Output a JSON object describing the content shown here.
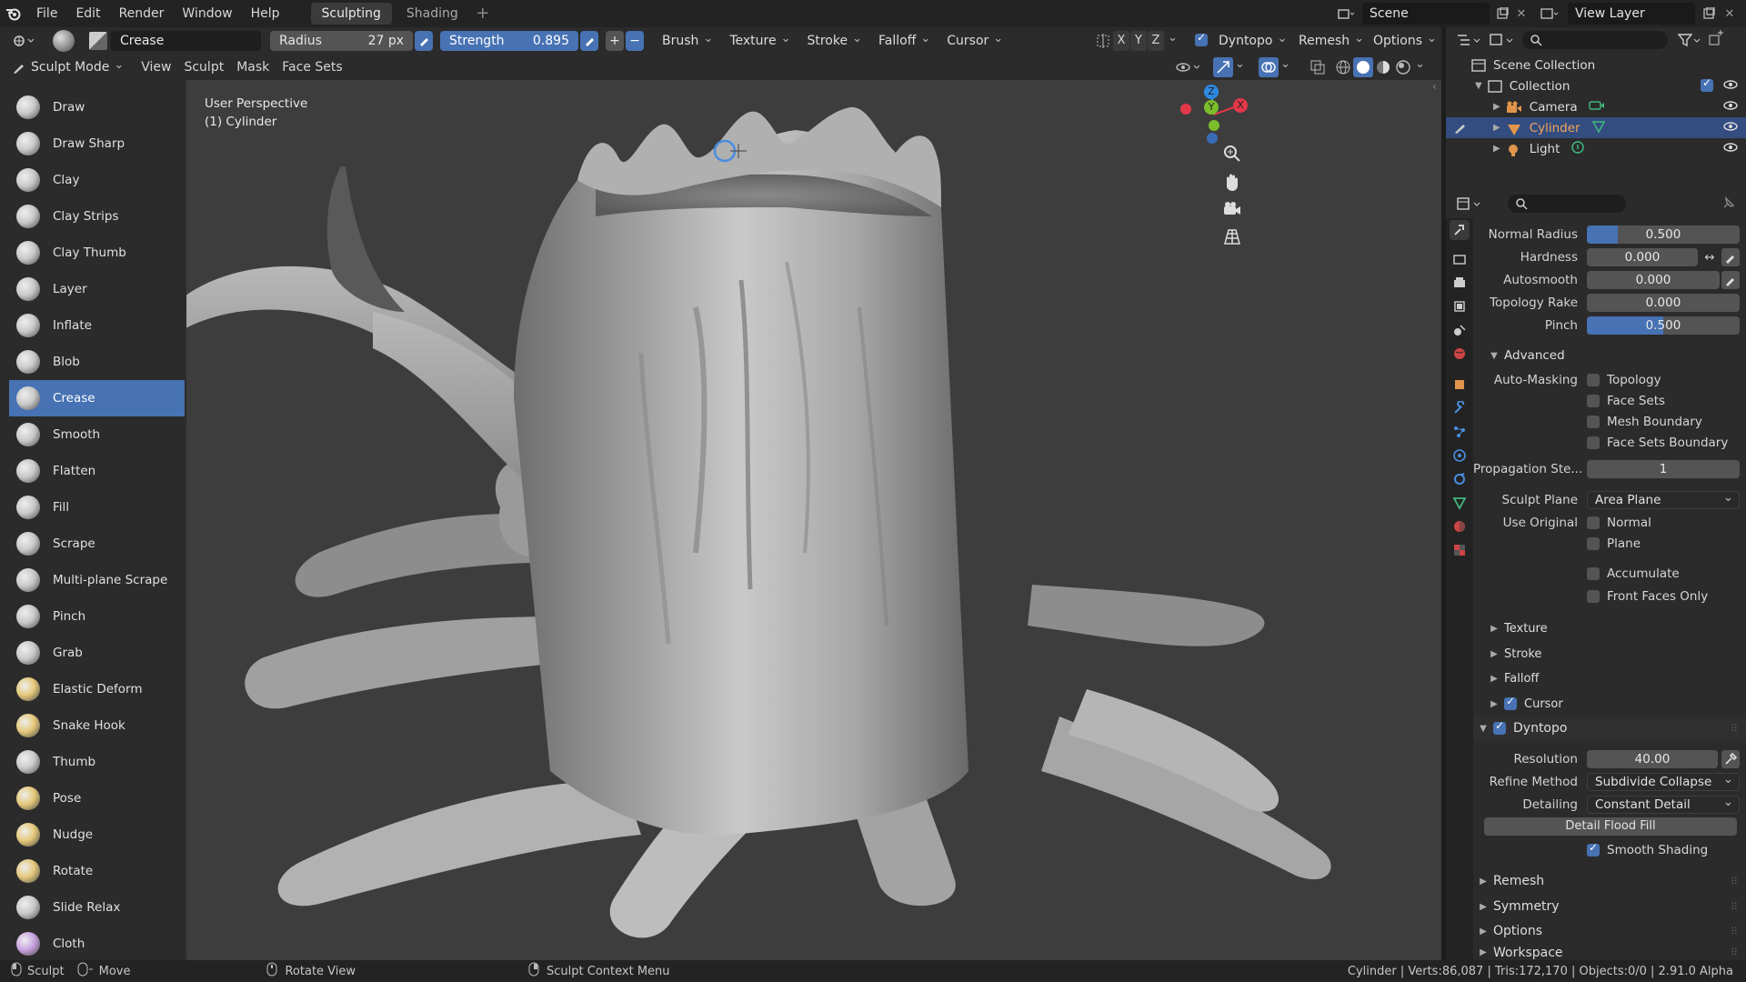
{
  "menubar": {
    "items": [
      "File",
      "Edit",
      "Render",
      "Window",
      "Help"
    ],
    "workspaces": [
      "Sculpting",
      "Shading"
    ],
    "add_workspace": "+",
    "scene": "Scene",
    "view_layer": "View Layer"
  },
  "toolhdr": {
    "brush_name": "Crease",
    "radius_label": "Radius",
    "radius_value": "27 px",
    "strength_label": "Strength",
    "strength_value": "0.895",
    "menus": [
      "Brush",
      "Texture",
      "Stroke",
      "Falloff",
      "Cursor"
    ],
    "axes": [
      "X",
      "Y",
      "Z"
    ],
    "dyntopo": "Dyntopo",
    "remesh": "Remesh",
    "options": "Options"
  },
  "modehdr": {
    "mode": "Sculpt Mode",
    "items": [
      "View",
      "Sculpt",
      "Mask",
      "Face Sets"
    ]
  },
  "tools": [
    {
      "label": "Draw"
    },
    {
      "label": "Draw Sharp"
    },
    {
      "label": "Clay"
    },
    {
      "label": "Clay Strips"
    },
    {
      "label": "Clay Thumb"
    },
    {
      "label": "Layer"
    },
    {
      "label": "Inflate"
    },
    {
      "label": "Blob"
    },
    {
      "label": "Crease"
    },
    {
      "label": "Smooth"
    },
    {
      "label": "Flatten"
    },
    {
      "label": "Fill"
    },
    {
      "label": "Scrape"
    },
    {
      "label": "Multi-plane Scrape"
    },
    {
      "label": "Pinch"
    },
    {
      "label": "Grab"
    },
    {
      "label": "Elastic Deform"
    },
    {
      "label": "Snake Hook"
    },
    {
      "label": "Thumb"
    },
    {
      "label": "Pose"
    },
    {
      "label": "Nudge"
    },
    {
      "label": "Rotate"
    },
    {
      "label": "Slide Relax"
    },
    {
      "label": "Cloth"
    }
  ],
  "active_tool": "Crease",
  "viewport": {
    "perspective": "User Perspective",
    "object": "(1) Cylinder",
    "gizmo": {
      "x": "X",
      "y": "Y",
      "z": "Z"
    }
  },
  "outliner": {
    "root": "Scene Collection",
    "collection": "Collection",
    "objects": [
      {
        "label": "Camera",
        "selected": false
      },
      {
        "label": "Cylinder",
        "selected": true
      },
      {
        "label": "Light",
        "selected": false
      }
    ]
  },
  "props": {
    "normal_radius": {
      "label": "Normal Radius",
      "value": "0.500",
      "fill": 0.2
    },
    "hardness": {
      "label": "Hardness",
      "value": "0.000"
    },
    "autosmooth": {
      "label": "Autosmooth",
      "value": "0.000"
    },
    "topology_rake": {
      "label": "Topology Rake",
      "value": "0.000"
    },
    "pinch": {
      "label": "Pinch",
      "value": "0.500",
      "fill": 0.5
    },
    "advanced": "Advanced",
    "auto_masking": "Auto-Masking",
    "masking_opts": [
      "Topology",
      "Face Sets",
      "Mesh Boundary",
      "Face Sets Boundary"
    ],
    "propagation": {
      "label": "Propagation Ste...",
      "value": "1"
    },
    "sculpt_plane": {
      "label": "Sculpt Plane",
      "value": "Area Plane"
    },
    "use_original": {
      "label": "Use Original",
      "opts": [
        "Normal",
        "Plane"
      ]
    },
    "accumulate": "Accumulate",
    "front_faces": "Front Faces Only",
    "sub_sections": [
      "Texture",
      "Stroke",
      "Falloff"
    ],
    "cursor": "Cursor",
    "dyntopo": "Dyntopo",
    "resolution": {
      "label": "Resolution",
      "value": "40.00"
    },
    "refine": {
      "label": "Refine Method",
      "value": "Subdivide Collapse"
    },
    "detailing": {
      "label": "Detailing",
      "value": "Constant Detail"
    },
    "flood_fill": "Detail Flood Fill",
    "smooth_shading": "Smooth Shading",
    "bottom_sections": [
      "Remesh",
      "Symmetry",
      "Options",
      "Workspace"
    ]
  },
  "statusbar": {
    "sculpt": "Sculpt",
    "move": "Move",
    "rotate": "Rotate View",
    "context": "Sculpt Context Menu",
    "stats": "Cylinder | Verts:86,087 | Tris:172,170 | Objects:0/0 | 2.91.0 Alpha"
  },
  "colors": {
    "accent": "#4772b3",
    "selected_row": "#334d80",
    "viewport_bg": "#3d3d3d"
  }
}
